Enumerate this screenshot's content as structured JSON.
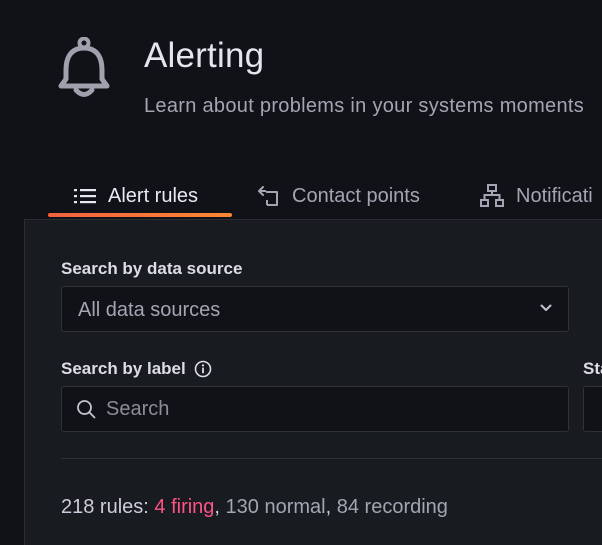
{
  "header": {
    "icon": "bell-icon",
    "title": "Alerting",
    "subtitle": "Learn about problems in your systems moments"
  },
  "tabs": [
    {
      "label": "Alert rules",
      "icon": "list-icon",
      "active": true
    },
    {
      "label": "Contact points",
      "icon": "contact-points-icon",
      "active": false
    },
    {
      "label": "Notificati",
      "icon": "sitemap-icon",
      "active": false
    }
  ],
  "filters": {
    "datasource_label": "Search by data source",
    "datasource_value": "All data sources",
    "label_search_label": "Search by label",
    "label_search_placeholder": "Search",
    "state_label": "Sta"
  },
  "summary": {
    "prefix": "218 rules: ",
    "firing": "4 firing",
    "sep1": ", ",
    "normal": "130 normal",
    "sep2": ", ",
    "recording": "84 recording"
  },
  "colors": {
    "background": "#111217",
    "panel": "#181b1f",
    "accent_gradient_start": "#f55f3e",
    "accent_gradient_end": "#ff8833",
    "firing": "#ff5286"
  }
}
